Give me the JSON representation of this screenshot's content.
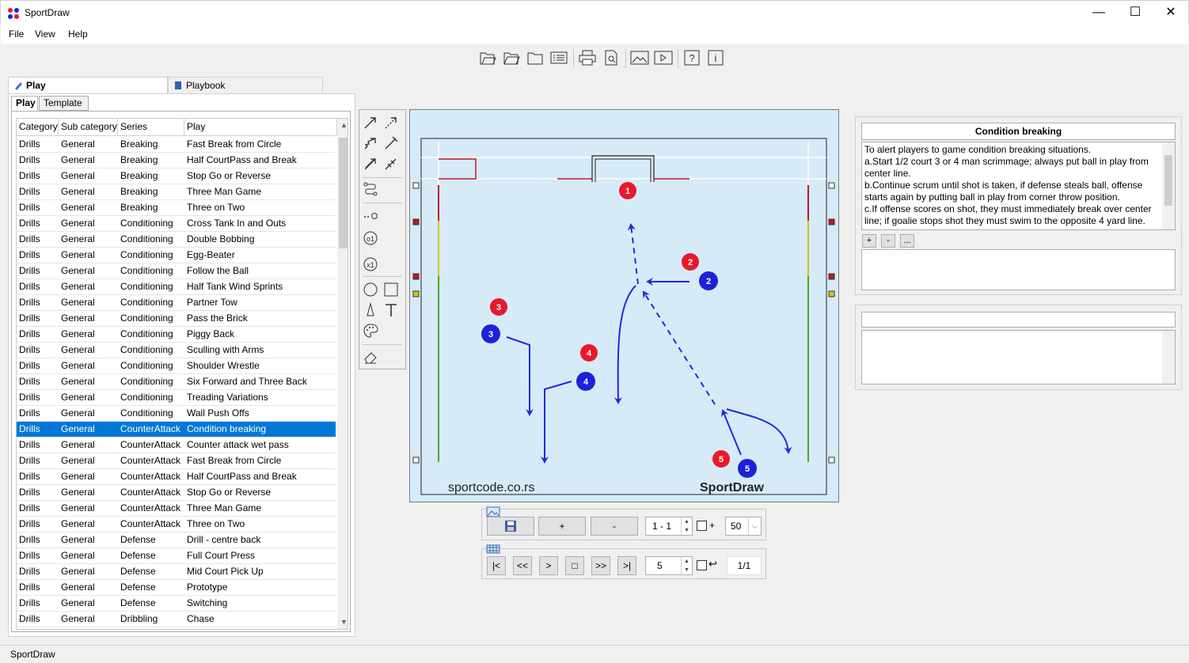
{
  "window": {
    "title": "SportDraw",
    "minimize": "—",
    "maximize": "☐",
    "close": "✕"
  },
  "menu": [
    "File",
    "View",
    "Help"
  ],
  "toolbar_icons": [
    "open-file-icon",
    "open-folder-icon",
    "folder-icon",
    "list-icon",
    "print-icon",
    "print-preview-icon",
    "image-icon",
    "video-icon",
    "help-icon",
    "info-icon"
  ],
  "main_tabs": [
    {
      "label": "Play"
    },
    {
      "label": "Playbook"
    }
  ],
  "sub_tabs": [
    {
      "label": "Play"
    },
    {
      "label": "Template"
    }
  ],
  "table": {
    "columns": [
      "Category",
      "Sub category",
      "Series",
      "Play"
    ],
    "rows": [
      [
        "Drills",
        "General",
        "Breaking",
        "Fast Break from Circle"
      ],
      [
        "Drills",
        "General",
        "Breaking",
        "Half CourtPass and Break"
      ],
      [
        "Drills",
        "General",
        "Breaking",
        "Stop Go or Reverse"
      ],
      [
        "Drills",
        "General",
        "Breaking",
        "Three Man Game"
      ],
      [
        "Drills",
        "General",
        "Breaking",
        "Three on Two"
      ],
      [
        "Drills",
        "General",
        "Conditioning",
        "Cross Tank In and Outs"
      ],
      [
        "Drills",
        "General",
        "Conditioning",
        "Double Bobbing"
      ],
      [
        "Drills",
        "General",
        "Conditioning",
        "Egg-Beater"
      ],
      [
        "Drills",
        "General",
        "Conditioning",
        "Follow the Ball"
      ],
      [
        "Drills",
        "General",
        "Conditioning",
        "Half Tank Wind Sprints"
      ],
      [
        "Drills",
        "General",
        "Conditioning",
        "Partner Tow"
      ],
      [
        "Drills",
        "General",
        "Conditioning",
        "Pass the Brick"
      ],
      [
        "Drills",
        "General",
        "Conditioning",
        "Piggy Back"
      ],
      [
        "Drills",
        "General",
        "Conditioning",
        "Sculling with Arms"
      ],
      [
        "Drills",
        "General",
        "Conditioning",
        "Shoulder Wrestle"
      ],
      [
        "Drills",
        "General",
        "Conditioning",
        "Six Forward and Three Back"
      ],
      [
        "Drills",
        "General",
        "Conditioning",
        "Treading Variations"
      ],
      [
        "Drills",
        "General",
        "Conditioning",
        "Wall Push Offs"
      ],
      [
        "Drills",
        "General",
        "CounterAttack",
        "Condition breaking"
      ],
      [
        "Drills",
        "General",
        "CounterAttack",
        "Counter attack wet pass"
      ],
      [
        "Drills",
        "General",
        "CounterAttack",
        "Fast Break from Circle"
      ],
      [
        "Drills",
        "General",
        "CounterAttack",
        "Half CourtPass and Break"
      ],
      [
        "Drills",
        "General",
        "CounterAttack",
        "Stop Go or Reverse"
      ],
      [
        "Drills",
        "General",
        "CounterAttack",
        "Three Man Game"
      ],
      [
        "Drills",
        "General",
        "CounterAttack",
        "Three on Two"
      ],
      [
        "Drills",
        "General",
        "Defense",
        "Drill - centre back"
      ],
      [
        "Drills",
        "General",
        "Defense",
        "Full Court Press"
      ],
      [
        "Drills",
        "General",
        "Defense",
        "Mid Court Pick Up"
      ],
      [
        "Drills",
        "General",
        "Defense",
        "Prototype"
      ],
      [
        "Drills",
        "General",
        "Defense",
        "Switching"
      ],
      [
        "Drills",
        "General",
        "Dribbling",
        "Chase"
      ]
    ],
    "selected_index": 18
  },
  "canvas": {
    "watermark_left": "sportcode.co.rs",
    "watermark_right": "SportDraw",
    "red_players": [
      "1",
      "2",
      "3",
      "4",
      "5"
    ],
    "blue_players": [
      "2",
      "3",
      "4",
      "5"
    ]
  },
  "frame_controls": {
    "add": "+",
    "remove": "-",
    "frame_range": "1 - 1",
    "plus_label": "+",
    "zoom": "50"
  },
  "playback": {
    "first": "|<",
    "prev_fast": "<<",
    "play": ">",
    "stop": "□",
    "next_fast": ">>",
    "last": ">|",
    "speed": "5",
    "page": "1/1"
  },
  "details": {
    "title": "Condition breaking",
    "description": [
      "To alert players to game condition breaking situations.",
      "a.Start 1/2 court 3 or 4 man scrimmage; always put ball in play from center line.",
      "b.Continue scrum until shot is taken, if defense steals ball, offense starts again by putting ball in play from corner throw position.",
      "c.If offense scores on shot, they must immediately break over center line; if goalie stops shot they must swim to the opposite 4 yard line."
    ],
    "buttons": [
      "+",
      "-",
      "..."
    ]
  },
  "status": "SportDraw",
  "colors": {
    "red": "#e8192c",
    "blue": "#1d22d8",
    "arrow": "#1e2be0",
    "pool": "#d6ebf7",
    "selection": "#0078d7"
  }
}
